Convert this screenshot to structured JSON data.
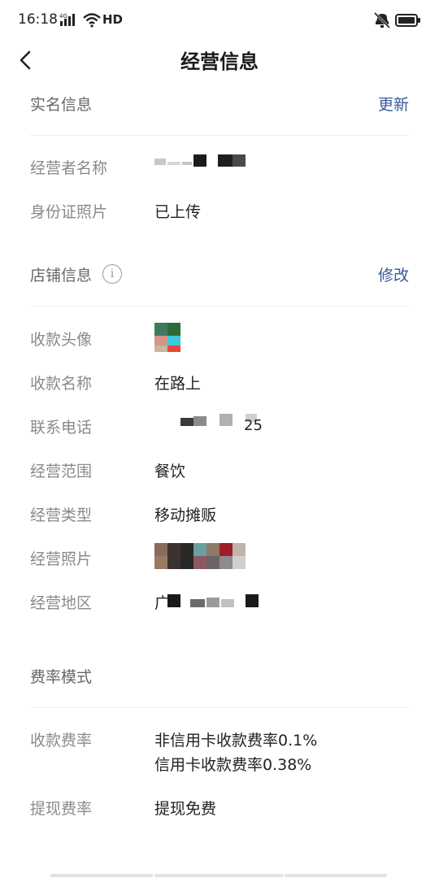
{
  "status": {
    "time": "16:18",
    "hd": "HD",
    "net_type": "4G"
  },
  "nav": {
    "title": "经营信息"
  },
  "real_name": {
    "title": "实名信息",
    "action": "更新",
    "rows": [
      {
        "label": "经营者名称",
        "value": ""
      },
      {
        "label": "身份证照片",
        "value": "已上传"
      }
    ]
  },
  "shop": {
    "title": "店铺信息",
    "action": "修改",
    "rows": [
      {
        "label": "收款头像",
        "value": ""
      },
      {
        "label": "收款名称",
        "value": "在路上"
      },
      {
        "label": "联系电话",
        "value": "25"
      },
      {
        "label": "经营范围",
        "value": "餐饮"
      },
      {
        "label": "经营类型",
        "value": "移动摊贩"
      },
      {
        "label": "经营照片",
        "value": ""
      },
      {
        "label": "经营地区",
        "value": "广"
      }
    ]
  },
  "fee": {
    "title": "费率模式",
    "rows": [
      {
        "label": "收款费率",
        "value_line1": "非信用卡收款费率0.1%",
        "value_line2": "信用卡收款费率0.38%"
      },
      {
        "label": "提现费率",
        "value": "提现免费"
      }
    ]
  },
  "colors": {
    "action": "#3a5a9a",
    "label": "#8a8a8a",
    "text": "#222222",
    "divider": "#eeeeee"
  }
}
